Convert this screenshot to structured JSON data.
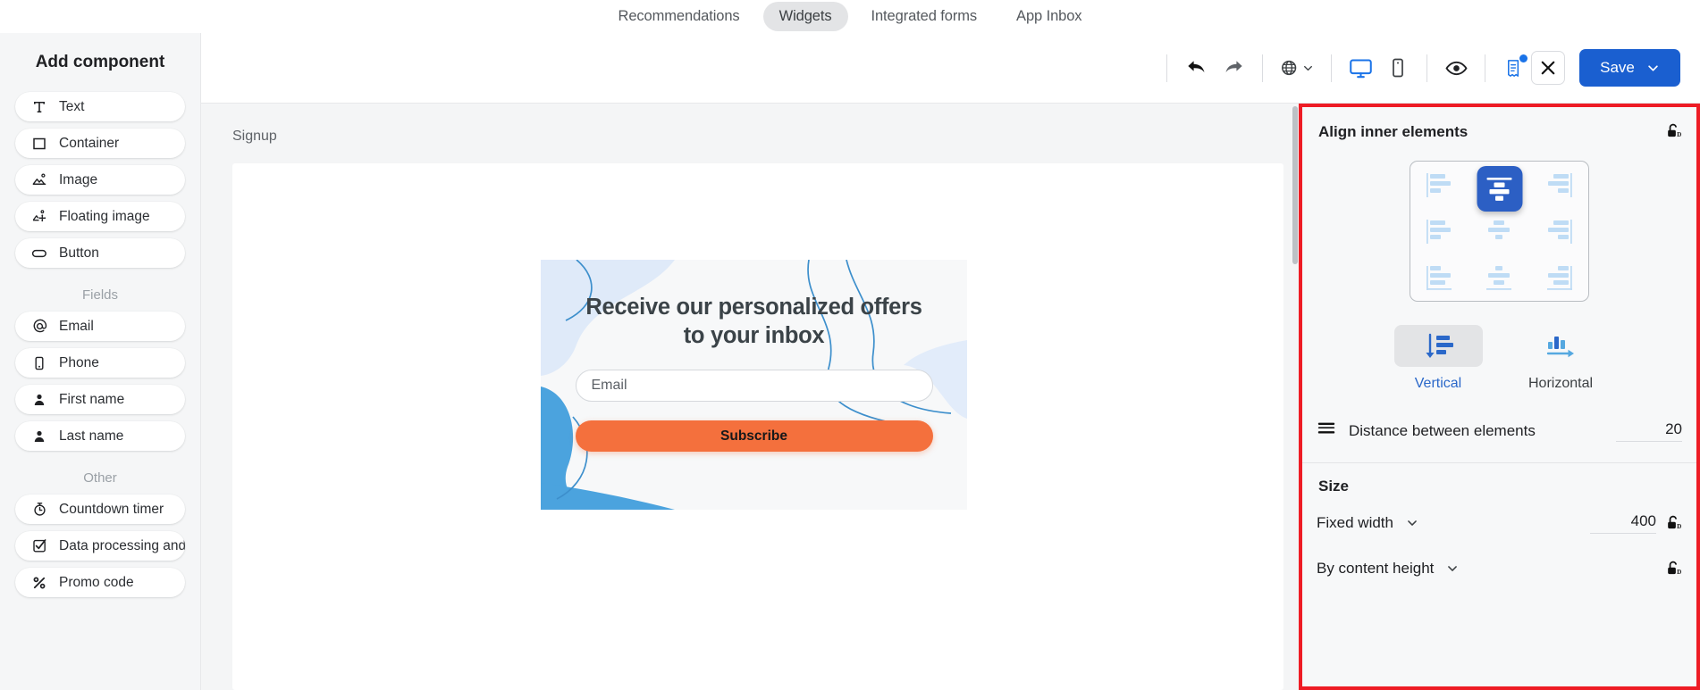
{
  "topnav": {
    "items": [
      {
        "label": "Recommendations",
        "active": false
      },
      {
        "label": "Widgets",
        "active": true
      },
      {
        "label": "Integrated forms",
        "active": false
      },
      {
        "label": "App Inbox",
        "active": false
      }
    ]
  },
  "sidebar": {
    "title": "Add component",
    "components": [
      {
        "label": "Text",
        "icon": "text-icon"
      },
      {
        "label": "Container",
        "icon": "container-icon"
      },
      {
        "label": "Image",
        "icon": "image-icon"
      },
      {
        "label": "Floating image",
        "icon": "floating-image-icon"
      },
      {
        "label": "Button",
        "icon": "button-icon"
      }
    ],
    "fields_label": "Fields",
    "fields": [
      {
        "label": "Email",
        "icon": "at-icon"
      },
      {
        "label": "Phone",
        "icon": "phone-icon"
      },
      {
        "label": "First name",
        "icon": "person-icon"
      },
      {
        "label": "Last name",
        "icon": "person-icon"
      }
    ],
    "other_label": "Other",
    "other": [
      {
        "label": "Countdown timer",
        "icon": "timer-icon"
      },
      {
        "label": "Data processing and",
        "icon": "checkbox-icon"
      },
      {
        "label": "Promo code",
        "icon": "percent-icon"
      }
    ]
  },
  "toolbar": {
    "undo": "undo-icon",
    "redo": "redo-icon",
    "language": "globe-icon",
    "desktop": "desktop-icon",
    "mobile": "mobile-icon",
    "preview": "eye-icon",
    "notes": "receipt-icon",
    "close": "close-icon",
    "save_label": "Save"
  },
  "canvas": {
    "label": "Signup",
    "widget": {
      "heading": "Receive our personalized offers to your inbox",
      "email_placeholder": "Email",
      "subscribe_label": "Subscribe",
      "accent_color": "#f4703d",
      "deco_color": "#4ba3de"
    }
  },
  "right_panel": {
    "align_title": "Align inner elements",
    "align_cells": [
      {
        "name": "top-left",
        "h": "left",
        "v": "top",
        "selected": false
      },
      {
        "name": "top-center",
        "h": "center",
        "v": "top",
        "selected": true
      },
      {
        "name": "top-right",
        "h": "right",
        "v": "top",
        "selected": false
      },
      {
        "name": "middle-left",
        "h": "left",
        "v": "middle",
        "selected": false
      },
      {
        "name": "middle-center",
        "h": "center",
        "v": "middle",
        "selected": false
      },
      {
        "name": "middle-right",
        "h": "right",
        "v": "middle",
        "selected": false
      },
      {
        "name": "bottom-left",
        "h": "left",
        "v": "bottom",
        "selected": false
      },
      {
        "name": "bottom-center",
        "h": "center",
        "v": "bottom",
        "selected": false
      },
      {
        "name": "bottom-right",
        "h": "right",
        "v": "bottom",
        "selected": false
      }
    ],
    "orientation": {
      "vertical_label": "Vertical",
      "horizontal_label": "Horizontal",
      "selected": "Vertical"
    },
    "distance_label": "Distance between elements",
    "distance_value": "20",
    "size_title": "Size",
    "width_mode": "Fixed width",
    "width_value": "400",
    "height_mode": "By content height",
    "highlight_color": "#ee1c25",
    "accent_blue": "#2c5fc4"
  }
}
